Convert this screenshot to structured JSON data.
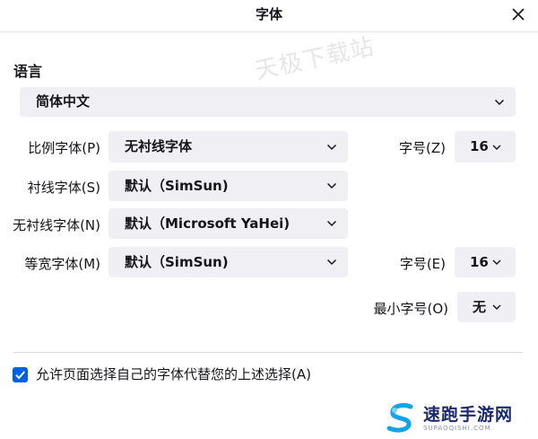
{
  "window": {
    "title": "字体"
  },
  "watermark": {
    "text": "天极下载站"
  },
  "language": {
    "section_title": "语言",
    "selected": "简体中文"
  },
  "proportional": {
    "label": "比例字体(P)",
    "value": "无衬线字体"
  },
  "size_proportional": {
    "label": "字号(Z)",
    "value": "16"
  },
  "serif": {
    "label": "衬线字体(S)",
    "value": "默认（SimSun)"
  },
  "sans_serif": {
    "label": "无衬线字体(N)",
    "value": "默认（Microsoft YaHei)"
  },
  "monospace": {
    "label": "等宽字体(M)",
    "value": "默认（SimSun)"
  },
  "size_monospace": {
    "label": "字号(E)",
    "value": "16"
  },
  "min_size": {
    "label": "最小字号(O)",
    "value": "无"
  },
  "allow_pages": {
    "label": "允许页面选择自己的字体代替您的上述选择(A)",
    "checked": true
  },
  "logo": {
    "name": "速跑手游网",
    "sub": "SUPAOQISHI.COM"
  },
  "colors": {
    "accent": "#0061e0",
    "select_bg": "#f0f0f4",
    "logo_text": "#1b2a6b"
  },
  "icons": {
    "close": "close-icon",
    "dropdown": "chevron-down-icon",
    "check": "checkmark-icon"
  }
}
